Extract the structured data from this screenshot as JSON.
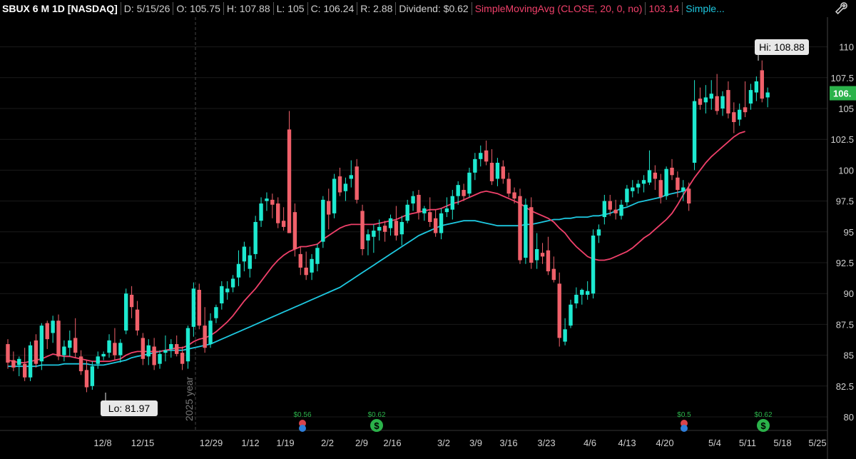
{
  "header": {
    "symbol": "SBUX 6 M 1D [NASDAQ]",
    "date": "D: 5/15/26",
    "open": "O: 105.75",
    "high": "H: 107.88",
    "low": "L: 105",
    "close": "C: 106.24",
    "range": "R: 2.88",
    "dividend": "Dividend: $0.62",
    "study1_name": "SimpleMovingAvg (CLOSE, 20, 0, no)",
    "study1_value": "103.14",
    "study2_name": "Simple..."
  },
  "colors": {
    "up": "#1de9d0",
    "down": "#f0606a",
    "sma20": "#f0406a",
    "sma50": "#1ec8e0",
    "background": "#000000",
    "grid": "#1a1a1a",
    "dividend": "#2bb24a"
  },
  "annotations": {
    "hi_label": "Hi: 108.88",
    "lo_label": "Lo: 81.97",
    "year_label": "2025 year",
    "last_price_badge": "106."
  },
  "dividends": [
    {
      "label": "$0.56",
      "date": "1/19"
    },
    {
      "label": "$0.62",
      "date": "2/9"
    },
    {
      "label": "$0.5",
      "date": "4/20"
    },
    {
      "label": "$0.62",
      "date": "5/11"
    }
  ],
  "chart_data": {
    "type": "candlestick",
    "y_ticks": [
      80,
      82.5,
      85,
      87.5,
      90,
      92.5,
      95,
      97.5,
      100,
      102.5,
      105,
      107.5,
      110
    ],
    "y_tick_labels": [
      "80",
      "82.5",
      "85",
      "87.5",
      "90",
      "92.5",
      "95",
      "97.5",
      "100",
      "102.5",
      "105",
      "107.5",
      "110"
    ],
    "x_tick_labels": [
      "12/8",
      "12/15",
      "12/29",
      "1/12",
      "1/19",
      "2/2",
      "2/9",
      "2/16",
      "3/2",
      "3/9",
      "3/16",
      "3/23",
      "4/6",
      "4/13",
      "4/20",
      "5/4",
      "5/11",
      "5/18",
      "5/25"
    ],
    "ylim": [
      78.5,
      111.5
    ],
    "candles": [
      {
        "o": 85.9,
        "h": 86.3,
        "l": 83.9,
        "c": 84.4
      },
      {
        "o": 84.6,
        "h": 85.3,
        "l": 83.7,
        "c": 84.0
      },
      {
        "o": 84.2,
        "h": 84.9,
        "l": 83.3,
        "c": 84.7
      },
      {
        "o": 84.3,
        "h": 85.6,
        "l": 82.9,
        "c": 83.2
      },
      {
        "o": 83.2,
        "h": 86.1,
        "l": 82.9,
        "c": 85.8
      },
      {
        "o": 86.2,
        "h": 86.7,
        "l": 84.0,
        "c": 84.3
      },
      {
        "o": 84.5,
        "h": 87.6,
        "l": 83.8,
        "c": 87.4
      },
      {
        "o": 87.6,
        "h": 87.8,
        "l": 85.5,
        "c": 86.3
      },
      {
        "o": 86.8,
        "h": 88.2,
        "l": 86.0,
        "c": 87.8
      },
      {
        "o": 87.8,
        "h": 88.3,
        "l": 84.6,
        "c": 84.9
      },
      {
        "o": 85.0,
        "h": 86.2,
        "l": 84.5,
        "c": 85.7
      },
      {
        "o": 85.6,
        "h": 87.0,
        "l": 84.9,
        "c": 86.2
      },
      {
        "o": 86.4,
        "h": 88.0,
        "l": 84.8,
        "c": 85.2
      },
      {
        "o": 84.9,
        "h": 85.4,
        "l": 83.4,
        "c": 83.7
      },
      {
        "o": 83.8,
        "h": 84.6,
        "l": 82.0,
        "c": 82.4
      },
      {
        "o": 82.5,
        "h": 84.5,
        "l": 82.2,
        "c": 84.1
      },
      {
        "o": 84.3,
        "h": 85.3,
        "l": 83.9,
        "c": 84.9
      },
      {
        "o": 84.9,
        "h": 85.3,
        "l": 84.6,
        "c": 85.1
      },
      {
        "o": 85.2,
        "h": 86.7,
        "l": 84.8,
        "c": 86.2
      },
      {
        "o": 86.0,
        "h": 87.2,
        "l": 84.6,
        "c": 85.0
      },
      {
        "o": 85.0,
        "h": 86.3,
        "l": 84.4,
        "c": 86.0
      },
      {
        "o": 87.0,
        "h": 90.4,
        "l": 86.7,
        "c": 90.0
      },
      {
        "o": 89.9,
        "h": 90.6,
        "l": 88.0,
        "c": 88.9
      },
      {
        "o": 88.7,
        "h": 89.4,
        "l": 86.6,
        "c": 87.0
      },
      {
        "o": 86.4,
        "h": 86.8,
        "l": 84.2,
        "c": 84.7
      },
      {
        "o": 84.9,
        "h": 86.3,
        "l": 84.2,
        "c": 85.8
      },
      {
        "o": 85.7,
        "h": 86.4,
        "l": 83.8,
        "c": 84.2
      },
      {
        "o": 84.3,
        "h": 85.4,
        "l": 83.9,
        "c": 85.1
      },
      {
        "o": 85.2,
        "h": 86.6,
        "l": 84.5,
        "c": 85.4
      },
      {
        "o": 85.5,
        "h": 86.3,
        "l": 84.8,
        "c": 85.9
      },
      {
        "o": 85.9,
        "h": 86.6,
        "l": 84.9,
        "c": 85.1
      },
      {
        "o": 85.2,
        "h": 85.7,
        "l": 83.8,
        "c": 84.3
      },
      {
        "o": 84.5,
        "h": 87.4,
        "l": 83.9,
        "c": 87.2
      },
      {
        "o": 87.3,
        "h": 90.9,
        "l": 86.5,
        "c": 90.4
      },
      {
        "o": 90.3,
        "h": 90.8,
        "l": 87.1,
        "c": 87.4
      },
      {
        "o": 87.4,
        "h": 88.9,
        "l": 85.2,
        "c": 85.6
      },
      {
        "o": 85.9,
        "h": 88.4,
        "l": 85.6,
        "c": 87.8
      },
      {
        "o": 88.0,
        "h": 89.1,
        "l": 87.6,
        "c": 88.9
      },
      {
        "o": 89.2,
        "h": 91.0,
        "l": 88.7,
        "c": 90.6
      },
      {
        "o": 90.1,
        "h": 91.0,
        "l": 89.5,
        "c": 90.4
      },
      {
        "o": 90.5,
        "h": 91.5,
        "l": 90.1,
        "c": 91.2
      },
      {
        "o": 91.3,
        "h": 93.5,
        "l": 90.6,
        "c": 92.4
      },
      {
        "o": 92.6,
        "h": 94.2,
        "l": 91.8,
        "c": 93.8
      },
      {
        "o": 92.0,
        "h": 93.8,
        "l": 91.3,
        "c": 93.1
      },
      {
        "o": 93.2,
        "h": 96.3,
        "l": 92.8,
        "c": 95.8
      },
      {
        "o": 95.9,
        "h": 97.8,
        "l": 95.4,
        "c": 97.3
      },
      {
        "o": 97.5,
        "h": 98.2,
        "l": 96.7,
        "c": 97.7
      },
      {
        "o": 97.6,
        "h": 98.1,
        "l": 96.1,
        "c": 97.2
      },
      {
        "o": 97.3,
        "h": 97.8,
        "l": 95.3,
        "c": 95.7
      },
      {
        "o": 95.9,
        "h": 97.0,
        "l": 95.1,
        "c": 95.4
      },
      {
        "o": 103.3,
        "h": 104.8,
        "l": 95.0,
        "c": 94.9
      },
      {
        "o": 96.6,
        "h": 97.3,
        "l": 93.0,
        "c": 93.6
      },
      {
        "o": 93.2,
        "h": 93.8,
        "l": 91.5,
        "c": 92.1
      },
      {
        "o": 92.1,
        "h": 93.4,
        "l": 91.1,
        "c": 91.5
      },
      {
        "o": 91.7,
        "h": 93.2,
        "l": 91.1,
        "c": 92.8
      },
      {
        "o": 92.4,
        "h": 94.0,
        "l": 91.8,
        "c": 93.7
      },
      {
        "o": 94.2,
        "h": 97.9,
        "l": 93.7,
        "c": 97.6
      },
      {
        "o": 97.5,
        "h": 98.5,
        "l": 95.2,
        "c": 96.4
      },
      {
        "o": 96.5,
        "h": 99.7,
        "l": 96.1,
        "c": 99.3
      },
      {
        "o": 99.5,
        "h": 100.2,
        "l": 97.9,
        "c": 98.2
      },
      {
        "o": 98.3,
        "h": 99.4,
        "l": 97.5,
        "c": 98.9
      },
      {
        "o": 99.3,
        "h": 100.8,
        "l": 98.6,
        "c": 99.6
      },
      {
        "o": 100.3,
        "h": 100.9,
        "l": 97.3,
        "c": 97.6
      },
      {
        "o": 96.7,
        "h": 97.2,
        "l": 93.1,
        "c": 93.6
      },
      {
        "o": 94.3,
        "h": 95.2,
        "l": 93.1,
        "c": 94.8
      },
      {
        "o": 94.6,
        "h": 95.6,
        "l": 93.3,
        "c": 95.1
      },
      {
        "o": 95.1,
        "h": 96.0,
        "l": 94.3,
        "c": 95.4
      },
      {
        "o": 95.5,
        "h": 95.9,
        "l": 94.2,
        "c": 95.0
      },
      {
        "o": 95.3,
        "h": 96.4,
        "l": 94.7,
        "c": 96.1
      },
      {
        "o": 95.9,
        "h": 97.1,
        "l": 94.3,
        "c": 94.7
      },
      {
        "o": 94.8,
        "h": 96.3,
        "l": 93.9,
        "c": 95.8
      },
      {
        "o": 95.9,
        "h": 97.6,
        "l": 95.7,
        "c": 97.2
      },
      {
        "o": 97.3,
        "h": 98.3,
        "l": 96.7,
        "c": 97.9
      },
      {
        "o": 98.0,
        "h": 98.4,
        "l": 96.0,
        "c": 96.6
      },
      {
        "o": 96.5,
        "h": 97.1,
        "l": 95.9,
        "c": 96.9
      },
      {
        "o": 96.6,
        "h": 97.8,
        "l": 95.4,
        "c": 95.8
      },
      {
        "o": 96.1,
        "h": 96.8,
        "l": 94.6,
        "c": 94.9
      },
      {
        "o": 94.9,
        "h": 96.9,
        "l": 94.4,
        "c": 96.5
      },
      {
        "o": 96.6,
        "h": 97.8,
        "l": 96.2,
        "c": 96.9
      },
      {
        "o": 96.8,
        "h": 98.4,
        "l": 96.0,
        "c": 97.9
      },
      {
        "o": 97.9,
        "h": 99.1,
        "l": 97.2,
        "c": 98.8
      },
      {
        "o": 98.4,
        "h": 98.9,
        "l": 97.5,
        "c": 97.9
      },
      {
        "o": 98.1,
        "h": 100.2,
        "l": 97.8,
        "c": 99.8
      },
      {
        "o": 99.8,
        "h": 101.4,
        "l": 99.2,
        "c": 100.9
      },
      {
        "o": 100.9,
        "h": 102.0,
        "l": 100.3,
        "c": 101.4
      },
      {
        "o": 101.6,
        "h": 102.4,
        "l": 100.4,
        "c": 100.7
      },
      {
        "o": 100.6,
        "h": 101.7,
        "l": 98.8,
        "c": 99.1
      },
      {
        "o": 99.3,
        "h": 101.0,
        "l": 98.7,
        "c": 100.6
      },
      {
        "o": 100.3,
        "h": 100.8,
        "l": 98.9,
        "c": 99.3
      },
      {
        "o": 99.3,
        "h": 99.8,
        "l": 97.8,
        "c": 98.1
      },
      {
        "o": 98.2,
        "h": 98.6,
        "l": 97.3,
        "c": 97.7
      },
      {
        "o": 97.9,
        "h": 98.5,
        "l": 92.4,
        "c": 92.7
      },
      {
        "o": 92.9,
        "h": 97.7,
        "l": 92.4,
        "c": 97.2
      },
      {
        "o": 97.0,
        "h": 97.8,
        "l": 92.0,
        "c": 92.5
      },
      {
        "o": 92.7,
        "h": 94.9,
        "l": 92.0,
        "c": 93.6
      },
      {
        "o": 93.3,
        "h": 94.1,
        "l": 92.4,
        "c": 93.0
      },
      {
        "o": 93.5,
        "h": 94.6,
        "l": 91.5,
        "c": 91.8
      },
      {
        "o": 92.0,
        "h": 93.0,
        "l": 90.9,
        "c": 91.1
      },
      {
        "o": 90.8,
        "h": 91.7,
        "l": 85.7,
        "c": 86.4
      },
      {
        "o": 86.1,
        "h": 88.0,
        "l": 85.8,
        "c": 87.1
      },
      {
        "o": 87.4,
        "h": 89.5,
        "l": 87.2,
        "c": 89.1
      },
      {
        "o": 89.2,
        "h": 90.5,
        "l": 88.8,
        "c": 89.9
      },
      {
        "o": 89.9,
        "h": 90.4,
        "l": 89.1,
        "c": 90.3
      },
      {
        "o": 89.9,
        "h": 91.0,
        "l": 89.5,
        "c": 90.2
      },
      {
        "o": 90.0,
        "h": 95.2,
        "l": 89.6,
        "c": 94.7
      },
      {
        "o": 94.7,
        "h": 95.6,
        "l": 94.1,
        "c": 95.2
      },
      {
        "o": 96.2,
        "h": 98.0,
        "l": 95.6,
        "c": 97.5
      },
      {
        "o": 97.5,
        "h": 98.0,
        "l": 96.3,
        "c": 96.8
      },
      {
        "o": 96.8,
        "h": 97.6,
        "l": 96.0,
        "c": 96.5
      },
      {
        "o": 96.3,
        "h": 97.6,
        "l": 96.0,
        "c": 97.2
      },
      {
        "o": 97.4,
        "h": 98.8,
        "l": 97.1,
        "c": 98.5
      },
      {
        "o": 98.3,
        "h": 99.2,
        "l": 97.8,
        "c": 98.6
      },
      {
        "o": 98.6,
        "h": 99.2,
        "l": 98.1,
        "c": 98.9
      },
      {
        "o": 98.9,
        "h": 99.6,
        "l": 98.2,
        "c": 99.2
      },
      {
        "o": 99.0,
        "h": 101.6,
        "l": 98.8,
        "c": 100.0
      },
      {
        "o": 99.8,
        "h": 100.4,
        "l": 98.4,
        "c": 99.3
      },
      {
        "o": 99.2,
        "h": 99.7,
        "l": 97.3,
        "c": 97.8
      },
      {
        "o": 97.9,
        "h": 100.3,
        "l": 97.6,
        "c": 100.1
      },
      {
        "o": 100.2,
        "h": 100.9,
        "l": 99.2,
        "c": 99.6
      },
      {
        "o": 99.4,
        "h": 99.9,
        "l": 97.8,
        "c": 98.4
      },
      {
        "o": 98.3,
        "h": 99.2,
        "l": 97.5,
        "c": 98.6
      },
      {
        "o": 98.5,
        "h": 99.0,
        "l": 96.7,
        "c": 97.3
      },
      {
        "o": 100.6,
        "h": 107.3,
        "l": 100.0,
        "c": 105.6
      },
      {
        "o": 105.8,
        "h": 106.7,
        "l": 104.9,
        "c": 105.3
      },
      {
        "o": 105.5,
        "h": 106.9,
        "l": 104.6,
        "c": 105.9
      },
      {
        "o": 105.8,
        "h": 107.3,
        "l": 104.9,
        "c": 106.2
      },
      {
        "o": 106.0,
        "h": 107.8,
        "l": 104.5,
        "c": 104.8
      },
      {
        "o": 105.0,
        "h": 106.4,
        "l": 104.4,
        "c": 106.0
      },
      {
        "o": 106.5,
        "h": 107.2,
        "l": 104.2,
        "c": 104.6
      },
      {
        "o": 104.7,
        "h": 105.5,
        "l": 103.0,
        "c": 103.9
      },
      {
        "o": 104.1,
        "h": 105.4,
        "l": 103.6,
        "c": 104.9
      },
      {
        "o": 105.1,
        "h": 107.2,
        "l": 104.3,
        "c": 104.7
      },
      {
        "o": 105.4,
        "h": 107.0,
        "l": 104.9,
        "c": 106.5
      },
      {
        "o": 106.3,
        "h": 107.6,
        "l": 105.6,
        "c": 107.2
      },
      {
        "o": 108.1,
        "h": 108.9,
        "l": 105.5,
        "c": 105.8
      },
      {
        "o": 105.9,
        "h": 106.7,
        "l": 105.1,
        "c": 106.3
      }
    ],
    "sma20": [
      84.6,
      84.5,
      84.4,
      84.4,
      84.5,
      84.6,
      84.7,
      84.9,
      85.1,
      85.0,
      84.9,
      84.9,
      84.8,
      84.7,
      84.6,
      84.5,
      84.5,
      84.5,
      84.5,
      84.6,
      84.7,
      85.0,
      85.2,
      85.3,
      85.3,
      85.3,
      85.3,
      85.3,
      85.4,
      85.5,
      85.6,
      85.6,
      85.8,
      86.1,
      86.3,
      86.4,
      86.6,
      86.9,
      87.3,
      87.7,
      88.2,
      88.8,
      89.4,
      89.9,
      90.4,
      91.0,
      91.6,
      92.2,
      92.7,
      93.1,
      93.4,
      93.6,
      93.8,
      93.8,
      93.9,
      94.0,
      94.4,
      94.7,
      95.0,
      95.3,
      95.5,
      95.6,
      95.6,
      95.6,
      95.6,
      95.6,
      95.7,
      95.8,
      95.9,
      96.0,
      96.2,
      96.4,
      96.5,
      96.6,
      96.7,
      96.8,
      96.8,
      96.9,
      97.1,
      97.3,
      97.4,
      97.6,
      97.8,
      98.0,
      98.2,
      98.3,
      98.2,
      98.1,
      97.9,
      97.7,
      97.5,
      97.3,
      97.0,
      96.7,
      96.5,
      96.3,
      96.1,
      95.8,
      95.3,
      94.9,
      94.3,
      93.8,
      93.4,
      93.0,
      92.8,
      92.7,
      92.7,
      92.8,
      93.0,
      93.2,
      93.4,
      93.7,
      94.1,
      94.5,
      94.8,
      95.2,
      95.6,
      96.0,
      96.5,
      97.2,
      98.0,
      98.7,
      99.4,
      100.0,
      100.6,
      101.1,
      101.5,
      101.9,
      102.3,
      102.7,
      103.0,
      103.14
    ],
    "sma50": [
      84.1,
      84.1,
      84.1,
      84.1,
      84.1,
      84.1,
      84.2,
      84.2,
      84.2,
      84.2,
      84.3,
      84.3,
      84.3,
      84.3,
      84.3,
      84.2,
      84.2,
      84.2,
      84.3,
      84.4,
      84.5,
      84.6,
      84.8,
      84.9,
      85.0,
      85.1,
      85.2,
      85.3,
      85.4,
      85.4,
      85.4,
      85.4,
      85.5,
      85.6,
      85.7,
      85.8,
      85.9,
      86.1,
      86.3,
      86.5,
      86.7,
      86.9,
      87.1,
      87.3,
      87.5,
      87.7,
      87.9,
      88.1,
      88.3,
      88.5,
      88.7,
      88.9,
      89.1,
      89.3,
      89.5,
      89.7,
      89.9,
      90.1,
      90.3,
      90.5,
      90.8,
      91.1,
      91.4,
      91.7,
      92.0,
      92.3,
      92.6,
      92.9,
      93.2,
      93.5,
      93.8,
      94.1,
      94.4,
      94.7,
      94.9,
      95.1,
      95.3,
      95.5,
      95.6,
      95.7,
      95.8,
      95.9,
      95.9,
      95.9,
      95.8,
      95.7,
      95.6,
      95.5,
      95.5,
      95.5,
      95.5,
      95.5,
      95.6,
      95.6,
      95.7,
      95.8,
      95.9,
      96.0,
      96.0,
      96.1,
      96.1,
      96.2,
      96.2,
      96.2,
      96.3,
      96.3,
      96.4,
      96.5,
      96.7,
      96.9,
      97.0,
      97.2,
      97.4,
      97.5,
      97.6,
      97.7,
      97.8,
      98.0,
      98.1,
      98.2,
      98.3,
      98.5
    ]
  }
}
